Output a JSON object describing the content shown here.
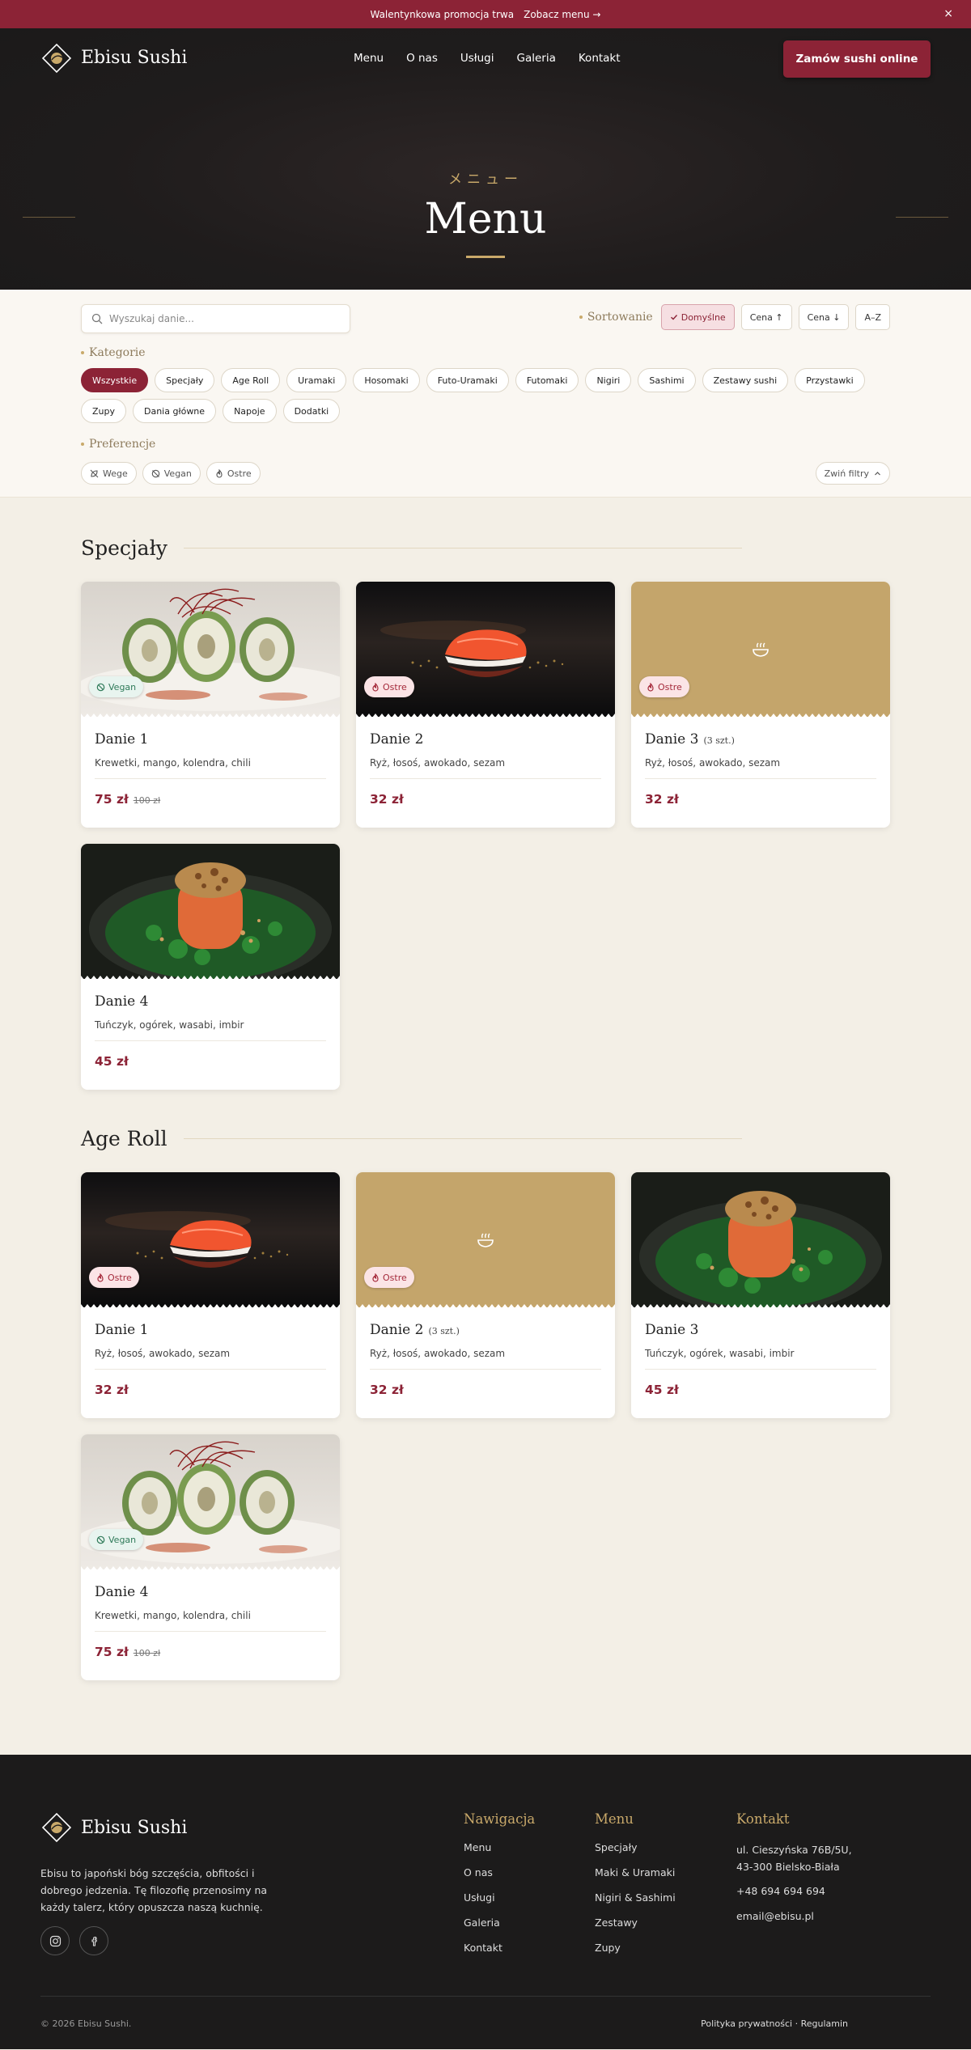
{
  "promo": {
    "text": "Walentynkowa promocja trwa",
    "link": "Zobacz menu →",
    "close": "×"
  },
  "brand": {
    "name": "Ebisu Sushi"
  },
  "nav": {
    "items": [
      "Menu",
      "O nas",
      "Usługi",
      "Galeria",
      "Kontakt"
    ],
    "cta": "Zamów sushi online"
  },
  "hero": {
    "jp": "メニュー",
    "title": "Menu"
  },
  "filters": {
    "search_placeholder": "Wyszukaj danie...",
    "sort_label": "Sortowanie",
    "sort_options": [
      "Domyślne",
      "Cena ↑",
      "Cena ↓",
      "A–Z"
    ],
    "sort_selected": "Domyślne",
    "categories_label": "Kategorie",
    "categories": [
      "Wszystkie",
      "Specjały",
      "Age Roll",
      "Uramaki",
      "Hosomaki",
      "Futo-Uramaki",
      "Futomaki",
      "Nigiri",
      "Sashimi",
      "Zestawy sushi",
      "Przystawki",
      "Zupy",
      "Dania główne",
      "Napoje",
      "Dodatki"
    ],
    "category_selected": "Wszystkie",
    "preferences_label": "Preferencje",
    "preferences": [
      "Wege",
      "Vegan",
      "Ostre"
    ],
    "collapse_label": "Zwiń filtry"
  },
  "sections": [
    {
      "title": "Specjały",
      "dishes": [
        {
          "name": "Danie 1",
          "qty": "",
          "desc": "Krewetki, mango, kolendra, chili",
          "price": "75 zł",
          "old_price": "100 zł",
          "badge": "Vegan",
          "image": "roll"
        },
        {
          "name": "Danie 2",
          "qty": "",
          "desc": "Ryż, łosoś, awokado, sezam",
          "price": "32 zł",
          "old_price": "",
          "badge": "Ostre",
          "image": "nigiri"
        },
        {
          "name": "Danie 3",
          "qty": "(3 szt.)",
          "desc": "Ryż, łosoś, awokado, sezam",
          "price": "32 zł",
          "old_price": "",
          "badge": "Ostre",
          "image": "placeholder"
        },
        {
          "name": "Danie 4",
          "qty": "",
          "desc": "Tuńczyk, ogórek, wasabi, imbir",
          "price": "45 zł",
          "old_price": "",
          "badge": "",
          "image": "bowl"
        }
      ]
    },
    {
      "title": "Age Roll",
      "dishes": [
        {
          "name": "Danie 1",
          "qty": "",
          "desc": "Ryż, łosoś, awokado, sezam",
          "price": "32 zł",
          "old_price": "",
          "badge": "Ostre",
          "image": "nigiri"
        },
        {
          "name": "Danie 2",
          "qty": "(3 szt.)",
          "desc": "Ryż, łosoś, awokado, sezam",
          "price": "32 zł",
          "old_price": "",
          "badge": "Ostre",
          "image": "placeholder"
        },
        {
          "name": "Danie 3",
          "qty": "",
          "desc": "Tuńczyk, ogórek, wasabi, imbir",
          "price": "45 zł",
          "old_price": "",
          "badge": "",
          "image": "bowl"
        },
        {
          "name": "Danie 4",
          "qty": "",
          "desc": "Krewetki, mango, kolendra, chili",
          "price": "75 zł",
          "old_price": "100 zł",
          "badge": "Vegan",
          "image": "roll"
        }
      ]
    }
  ],
  "footer": {
    "desc": "Ebisu to japoński bóg szczęścia, obfitości i dobrego jedzenia. Tę filozofię przenosimy na każdy talerz, który opuszcza naszą kuchnię.",
    "nav_title": "Nawigacja",
    "nav_links": [
      "Menu",
      "O nas",
      "Usługi",
      "Galeria",
      "Kontakt"
    ],
    "menu_title": "Menu",
    "menu_links": [
      "Specjały",
      "Maki & Uramaki",
      "Nigiri & Sashimi",
      "Zestawy",
      "Zupy"
    ],
    "contact_title": "Kontakt",
    "address_line1": "ul. Cieszyńska 76B/5U,",
    "address_line2": "43-300 Bielsko-Biała",
    "phone": "+48 694 694 694",
    "email": "email@ebisu.pl",
    "copyright": "© 2026 Ebisu Sushi.",
    "legal": "Polityka prywatności · Regulamin"
  },
  "colors": {
    "accent": "#8c2336",
    "gold": "#c9a96a",
    "dark": "#1c1b1b",
    "cream": "#f3efe6"
  }
}
